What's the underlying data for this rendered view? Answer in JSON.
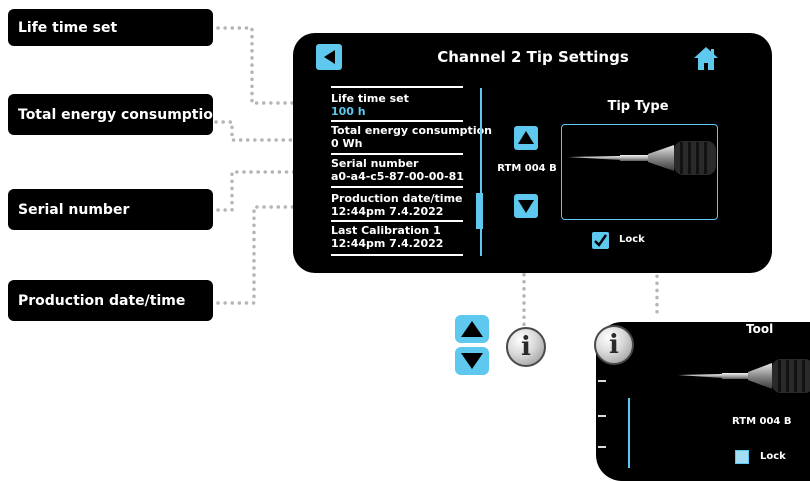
{
  "callouts": {
    "life_time_set": "Life time set",
    "total_energy": "Total energy consumption",
    "serial_number": "Serial number",
    "production_date": "Production date/time"
  },
  "main_screen": {
    "title": "Channel 2 Tip Settings",
    "fields": [
      {
        "label": "Life time set",
        "value": "100 h"
      },
      {
        "label": "Total energy consumption",
        "value": "0 Wh"
      },
      {
        "label": "Serial number",
        "value": "a0-a4-c5-87-00-00-81"
      },
      {
        "label": "Production date/time",
        "value": "12:44pm 7.4.2022"
      },
      {
        "label": "Last Calibration 1",
        "value": "12:44pm 7.4.2022"
      }
    ],
    "tip_model": "RTM 004 B",
    "tip_type_label": "Tip Type",
    "lock_label": "Lock"
  },
  "zoom_screen": {
    "title": "Tool",
    "tip_model": "RTM 004 B",
    "lock_label": "Lock"
  },
  "info_symbol": "i",
  "colors": {
    "accent": "#5ec8ee",
    "screen_bg": "#000000",
    "connector": "#b5b5b5"
  }
}
